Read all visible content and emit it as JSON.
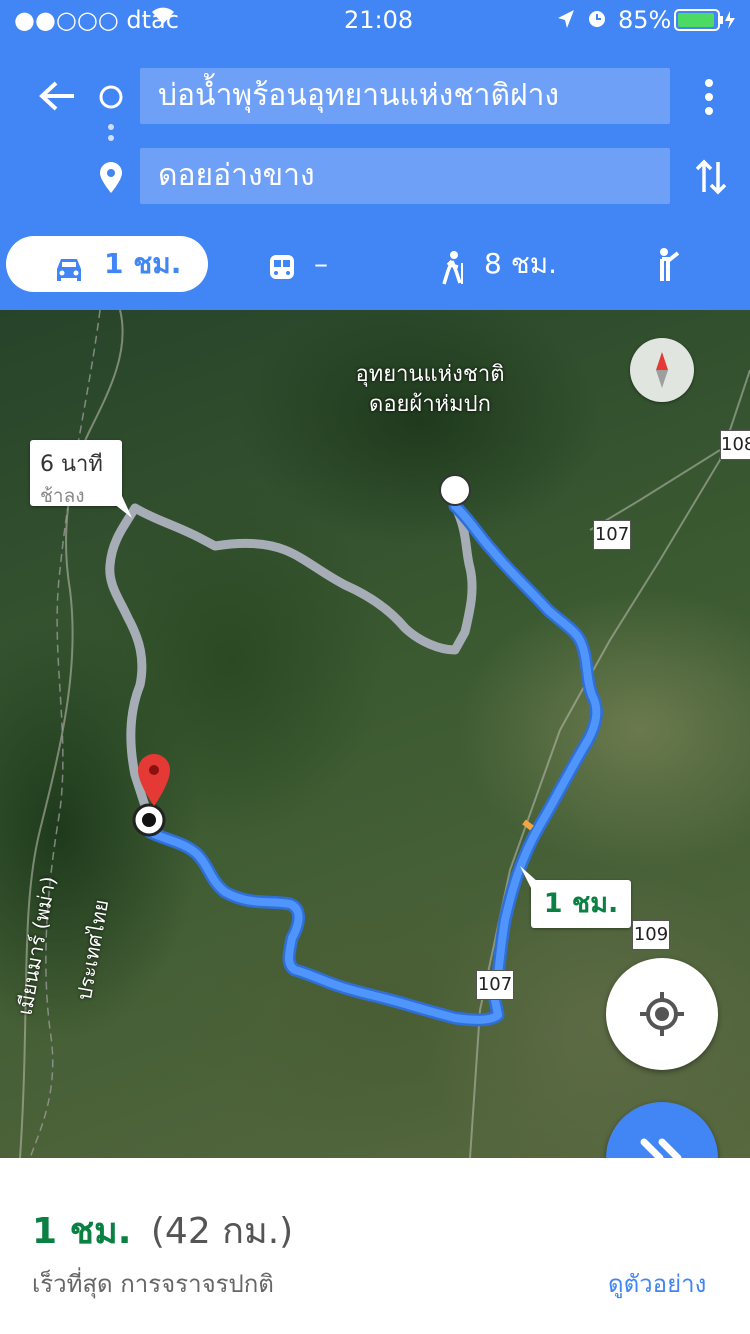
{
  "status_bar": {
    "carrier": "●●○○○ dtac",
    "time": "21:08",
    "battery": "85%"
  },
  "route": {
    "origin": "บ่อน้ำพุร้อนอุทยานแห่งชาติฝาง",
    "destination": "ดอยอ่างขาง"
  },
  "modes": [
    {
      "icon": "car-icon",
      "label": "1 ชม.",
      "active": true
    },
    {
      "icon": "train-icon",
      "label": "–",
      "active": false
    },
    {
      "icon": "walk-icon",
      "label": "8 ชม.",
      "active": false
    },
    {
      "icon": "ride-icon",
      "label": "",
      "active": false
    }
  ],
  "map": {
    "park_label_line1": "อุทยานแห่งชาติ",
    "park_label_line2": "ดอยผ้าห่มปก",
    "alt_route_time": "6 นาที",
    "alt_route_note": "ช้าลง",
    "route_time": "1 ชม.",
    "road_107_a": "107",
    "road_107_b": "107",
    "road_108": "108",
    "road_109": "109",
    "country_myanmar": "เมียนมาร์ (พม่า)",
    "country_thailand": "ประเทศไทย"
  },
  "summary": {
    "duration": "1 ชม.",
    "distance": "(42 กม.)",
    "note": "เร็วที่สุด การจราจรปกติ",
    "preview_link": "ดูตัวอย่าง"
  },
  "colors": {
    "primary": "#4285f4",
    "route": "#4a8af4",
    "green": "#0b8043"
  }
}
